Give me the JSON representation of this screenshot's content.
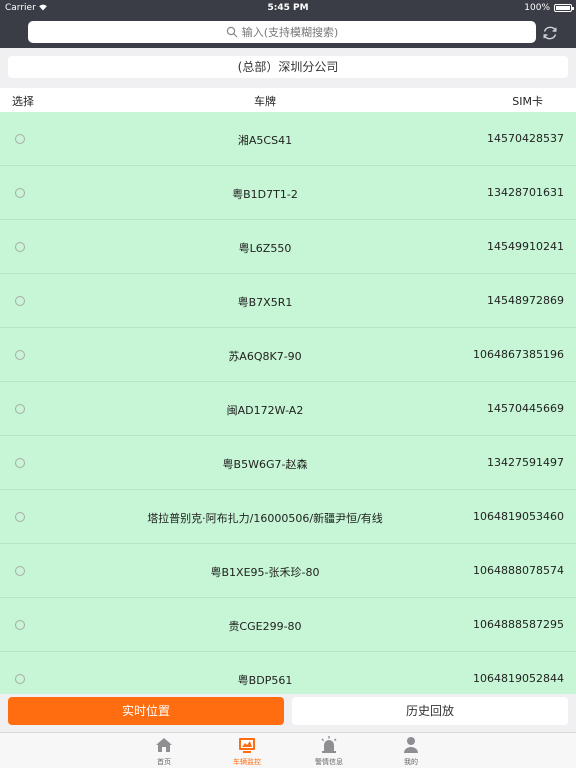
{
  "status_bar": {
    "carrier": "Carrier",
    "time": "5:45 PM",
    "battery": "100%"
  },
  "search": {
    "placeholder": "输入(支持模糊搜索)"
  },
  "company": {
    "label": "(总部）深圳分公司"
  },
  "table": {
    "headers": {
      "select": "选择",
      "plate": "车牌",
      "sim": "SIM卡"
    },
    "rows": [
      {
        "plate": "湘A5CS41",
        "sim": "14570428537"
      },
      {
        "plate": "粤B1D7T1-2",
        "sim": "13428701631"
      },
      {
        "plate": "粤L6Z550",
        "sim": "14549910241"
      },
      {
        "plate": "粤B7X5R1",
        "sim": "14548972869"
      },
      {
        "plate": "苏A6Q8K7-90",
        "sim": "1064867385196"
      },
      {
        "plate": "闽AD172W-A2",
        "sim": "14570445669"
      },
      {
        "plate": "粤B5W6G7-赵森",
        "sim": "13427591497"
      },
      {
        "plate": "塔拉普别克·阿布扎力/16000506/新疆尹恒/有线",
        "sim": "1064819053460"
      },
      {
        "plate": "粤B1XE95-张禾珍-80",
        "sim": "1064888078574"
      },
      {
        "plate": "贵CGE299-80",
        "sim": "1064888587295"
      },
      {
        "plate": "粤BDP561",
        "sim": "1064819052844"
      }
    ]
  },
  "actions": {
    "realtime_label": "实时位置",
    "history_label": "历史回放"
  },
  "tabs": [
    {
      "label": "首页",
      "icon": "home-icon"
    },
    {
      "label": "车辆监控",
      "icon": "monitor-icon"
    },
    {
      "label": "警情信息",
      "icon": "alarm-icon"
    },
    {
      "label": "我的",
      "icon": "person-icon"
    }
  ],
  "colors": {
    "accent": "#ff6d10",
    "row_bg": "#c6f6d5",
    "header_dark": "#3a3d45"
  }
}
